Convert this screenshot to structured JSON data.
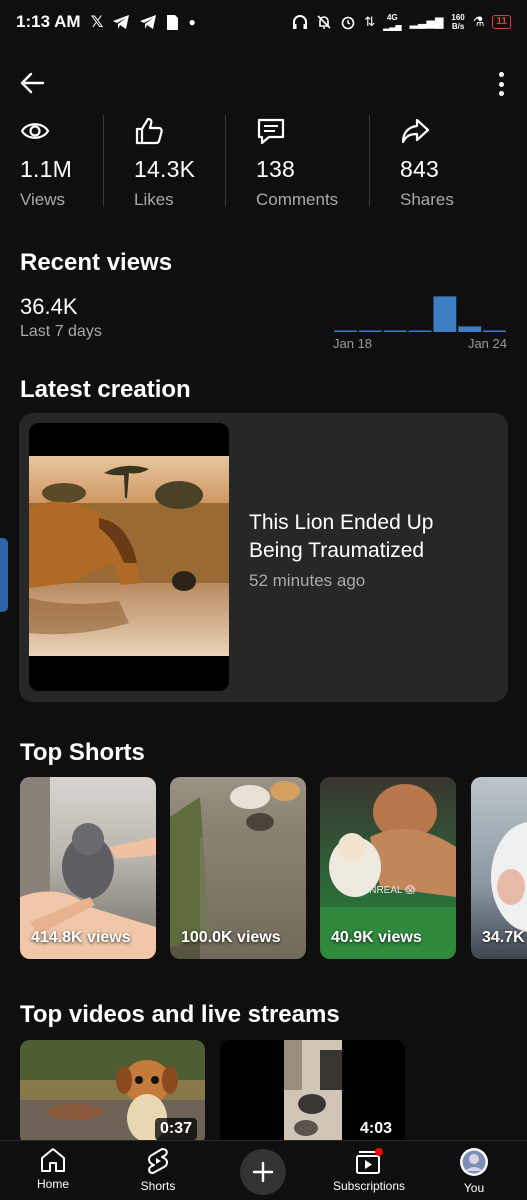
{
  "status_bar": {
    "time": "1:13 AM",
    "network_speed_value": "160",
    "network_speed_unit": "B/s",
    "network_type": "4G",
    "battery": "11",
    "battery_color": "#e53935"
  },
  "stats": [
    {
      "icon": "eye-icon",
      "value": "1.1M",
      "label": "Views"
    },
    {
      "icon": "thumbs-up-icon",
      "value": "14.3K",
      "label": "Likes"
    },
    {
      "icon": "comment-icon",
      "value": "138",
      "label": "Comments"
    },
    {
      "icon": "share-icon",
      "value": "843",
      "label": "Shares"
    }
  ],
  "recent_views": {
    "heading": "Recent views",
    "value": "36.4K",
    "period": "Last 7 days"
  },
  "chart_data": {
    "type": "bar",
    "categories": [
      "Jan 18",
      "",
      "",
      "",
      "",
      "",
      "Jan 24"
    ],
    "values": [
      0.5,
      0.5,
      0.5,
      0.5,
      32,
      5,
      0.8
    ],
    "xlabel": "",
    "ylabel": "",
    "ylim": [
      0,
      36
    ],
    "color": "#3e7cc4",
    "grid": false
  },
  "latest_creation": {
    "heading": "Latest creation",
    "title": "This Lion Ended Up Being Traumatized",
    "time_ago": "52 minutes ago"
  },
  "top_shorts": {
    "heading": "Top Shorts",
    "items": [
      {
        "views": "414.8K views"
      },
      {
        "views": "100.0K views"
      },
      {
        "views": "40.9K views",
        "overlay_text": "UNREAL 😱"
      },
      {
        "views": "34.7K"
      }
    ]
  },
  "top_videos": {
    "heading": "Top videos and live streams",
    "items": [
      {
        "duration": "0:37"
      },
      {
        "duration": "4:03"
      }
    ]
  },
  "bottom_nav": {
    "home": "Home",
    "shorts": "Shorts",
    "subscriptions": "Subscriptions",
    "you": "You"
  },
  "colors": {
    "background": "#0f0f0f",
    "card": "#272727",
    "accent_blue": "#3e7cc4",
    "notification_red": "#ff0000"
  }
}
